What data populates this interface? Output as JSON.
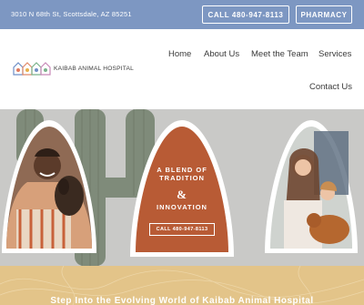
{
  "topbar": {
    "address": "3010 N 68th St, Scottsdale, AZ 85251",
    "call_label": "CALL 480-947-8113",
    "pharmacy_label": "PHARMACY",
    "bg_color": "#7d97c2"
  },
  "logo": {
    "text": "KAIBAB ANIMAL HOSPITAL"
  },
  "nav": {
    "items": [
      "Home",
      "About Us",
      "Meet the Team",
      "Services",
      "Contact Us"
    ]
  },
  "hero": {
    "tagline_line1": "A BLEND OF TRADITION",
    "tagline_amp": "&",
    "tagline_line3": "INNOVATION",
    "call_label": "CALL 480-947-8113",
    "arch_color": "#b85b35",
    "bg_color": "#c9c9c7"
  },
  "band": {
    "title": "Step Into the Evolving World of Kaibab Animal Hospital",
    "bg_color": "#e3c489"
  }
}
